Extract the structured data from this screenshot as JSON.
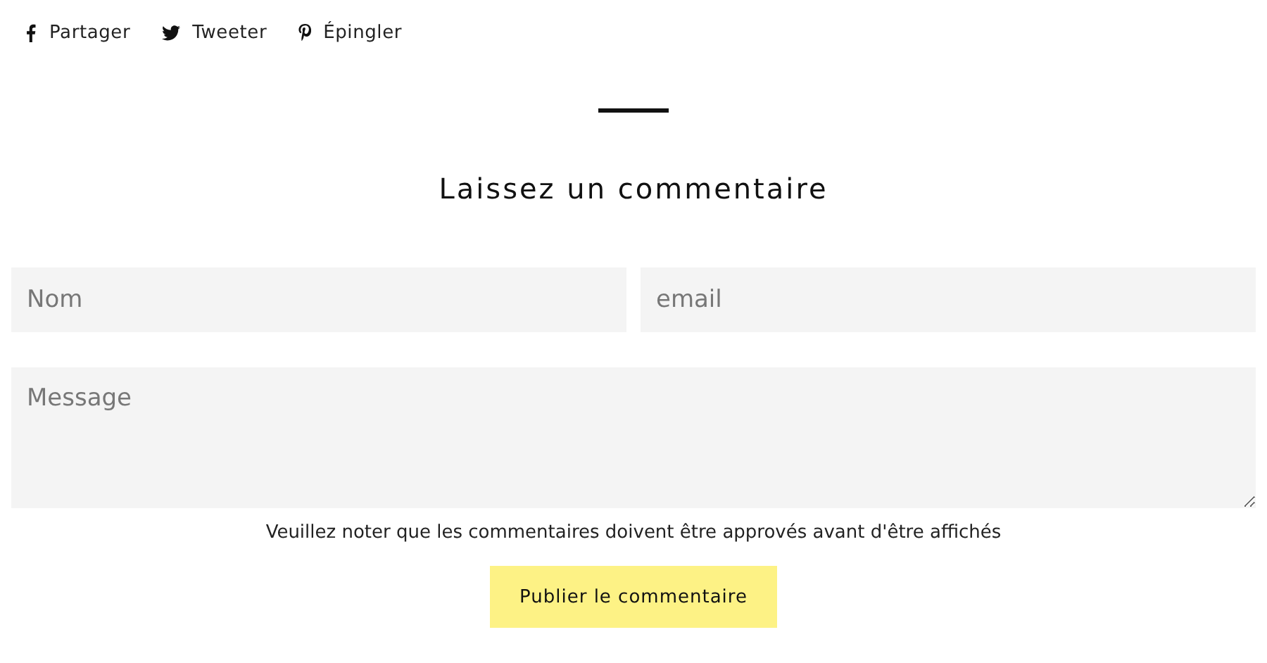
{
  "share_links": [
    {
      "kind": "facebook",
      "label": "Partager"
    },
    {
      "kind": "twitter",
      "label": "Tweeter"
    },
    {
      "kind": "pinterest",
      "label": "Épingler"
    }
  ],
  "heading": "Laissez un commentaire",
  "form": {
    "name_field": {
      "placeholder": "Nom"
    },
    "email_field": {
      "placeholder": "email"
    },
    "message_field": {
      "placeholder": "Message"
    },
    "note": "Veuillez noter que les commentaires doivent être approvés avant d'être affichés",
    "submit_button": "Publier le commentaire"
  }
}
